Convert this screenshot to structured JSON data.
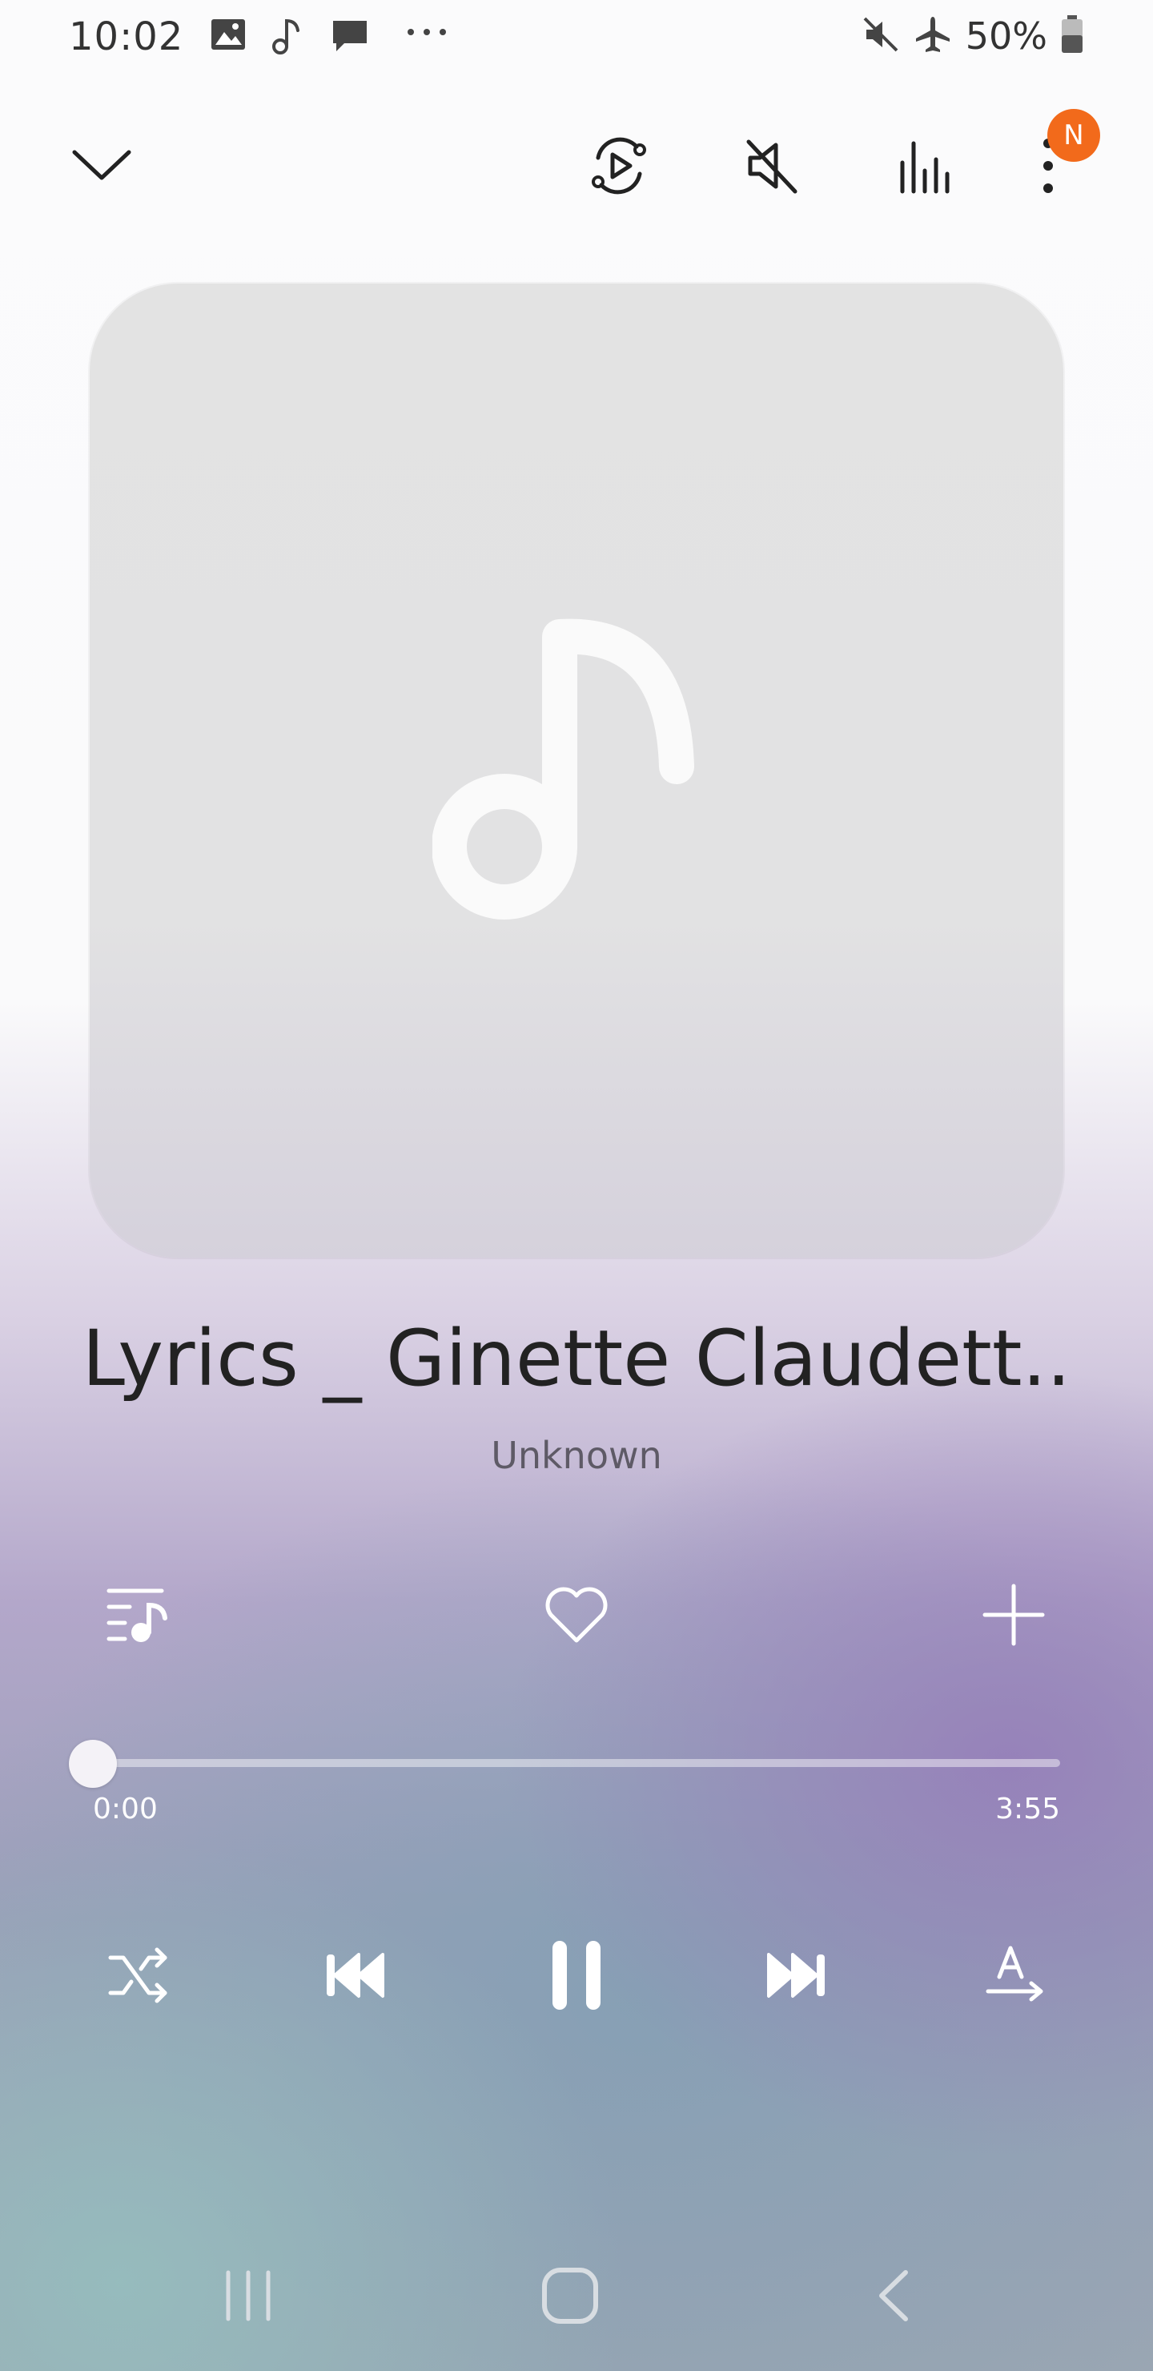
{
  "status_bar": {
    "time": "10:02",
    "battery": "50%",
    "icons": [
      "image-icon",
      "music-note-icon",
      "message-icon",
      "more-dots-icon",
      "mute-icon",
      "airplane-icon",
      "battery-icon"
    ]
  },
  "toolbar": {
    "icons": [
      "chevron-down-icon",
      "smart-view-icon",
      "volume-mute-icon",
      "equalizer-icon",
      "more-options-icon"
    ],
    "badge": "N",
    "badge_color": "#f26a1b"
  },
  "track": {
    "title": "Lyrics _ Ginette Claudett..",
    "artist": "Unknown"
  },
  "actions": [
    "queue-icon",
    "favorite-heart-icon",
    "add-icon"
  ],
  "progress": {
    "elapsed": "0:00",
    "duration": "3:55",
    "fraction": 0
  },
  "controls": [
    "shuffle-icon",
    "previous-icon",
    "pause-icon",
    "next-icon",
    "lyrics-translate-icon"
  ],
  "navbar": [
    "recents-icon",
    "home-icon",
    "back-icon"
  ]
}
